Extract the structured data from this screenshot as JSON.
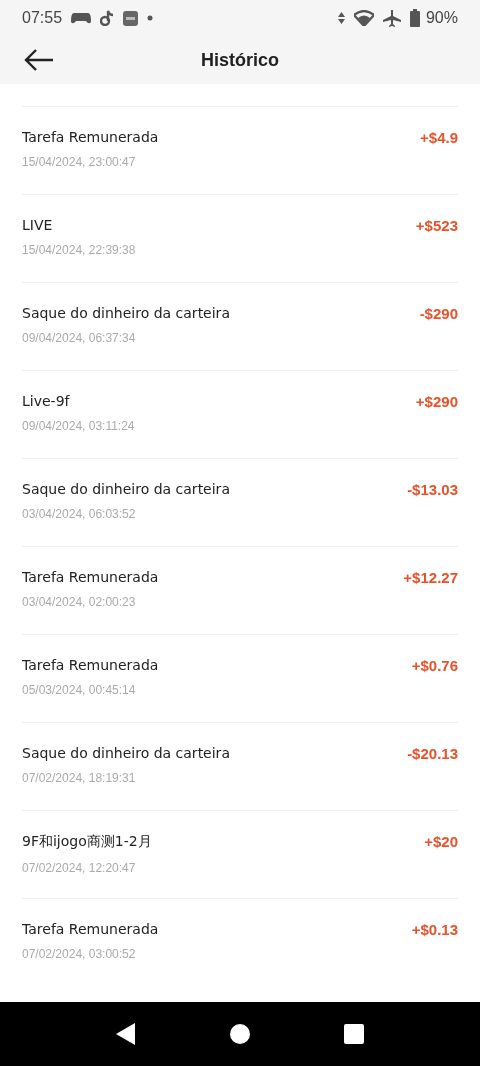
{
  "status_bar": {
    "time": "07:55",
    "battery": "90%"
  },
  "header": {
    "title": "Histórico"
  },
  "transactions": [
    {
      "title": "Tarefa Remunerada",
      "date": "15/04/2024, 23:00:47",
      "amount": "+$4.9"
    },
    {
      "title": "LIVE",
      "date": "15/04/2024, 22:39:38",
      "amount": "+$523"
    },
    {
      "title": "Saque do dinheiro da carteira",
      "date": "09/04/2024, 06:37:34",
      "amount": "-$290"
    },
    {
      "title": "Live-9f",
      "date": "09/04/2024, 03:11:24",
      "amount": "+$290"
    },
    {
      "title": "Saque do dinheiro da carteira",
      "date": "03/04/2024, 06:03:52",
      "amount": "-$13.03"
    },
    {
      "title": "Tarefa Remunerada",
      "date": "03/04/2024, 02:00:23",
      "amount": "+$12.27"
    },
    {
      "title": "Tarefa Remunerada",
      "date": "05/03/2024, 00:45:14",
      "amount": "+$0.76"
    },
    {
      "title": "Saque do dinheiro da carteira",
      "date": "07/02/2024, 18:19:31",
      "amount": "-$20.13"
    },
    {
      "title": "9F和ijogo商测1-2月",
      "date": "07/02/2024, 12:20:47",
      "amount": "+$20"
    },
    {
      "title": "Tarefa Remunerada",
      "date": "07/02/2024, 03:00:52",
      "amount": "+$0.13"
    }
  ]
}
